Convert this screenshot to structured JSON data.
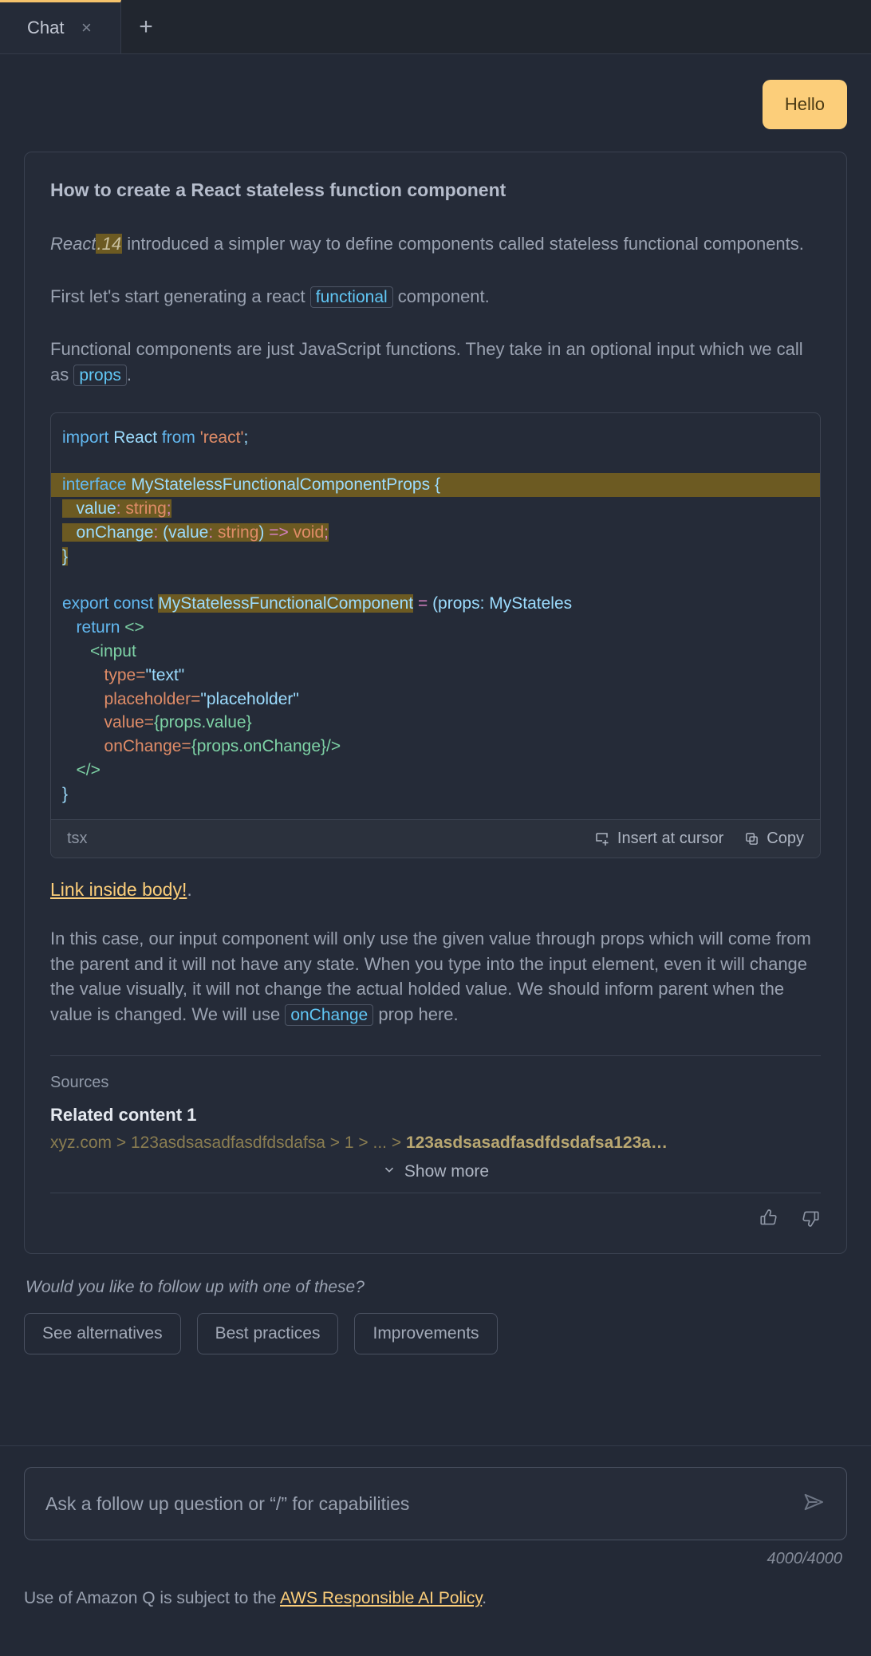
{
  "tabbar": {
    "tab_label": "Chat",
    "close_glyph": "×",
    "new_tab_glyph": "+"
  },
  "conversation": {
    "user_message": "Hello",
    "answer": {
      "title": "How to create a React stateless function component",
      "p1_a": "React",
      "p1_hl": ".14",
      "p1_b": " introduced a simpler way to define components called stateless functional components.",
      "p2_a": "First let's start generating a react ",
      "p2_code": "functional",
      "p2_b": " component.",
      "p3_a": "Functional components are just JavaScript functions. They take in an optional input which we call as ",
      "p3_code": "props",
      "p3_b": ".",
      "link_text": "Link inside body!",
      "link_suffix": ".",
      "p4_a": "In this case, our input component will only use the given value through props which will come from the parent and it will not have any state. When you type into the input element, even it will change the value visually, it will not change the actual holded value. We should inform parent when the value is changed. We will use ",
      "p4_code": "onChange",
      "p4_b": " prop here."
    },
    "code_block": {
      "language": "tsx",
      "insert_label": "Insert at cursor",
      "copy_label": "Copy",
      "lines": [
        "import React from 'react';",
        "",
        "interface MyStatelessFunctionalComponentProps {",
        "    value: string;",
        "    onChange: (value: string) => void;",
        "}",
        "",
        "export const MyStatelessFunctionalComponent = (props: MyStateles",
        "    return <>",
        "        <input",
        "            type=\"text\"",
        "            placeholder=\"placeholder\"",
        "            value={props.value}",
        "            onChange={props.onChange}/>",
        "    </>",
        "}"
      ]
    },
    "sources": {
      "label": "Sources",
      "items": [
        {
          "title": "Related content 1",
          "crumb_prefix": "xyz.com > 123asdsasadfasdfdsdafsa > 1 > ... > ",
          "crumb_last": "123asdsasadfasdfdsdafsa123a…"
        }
      ],
      "show_more_label": "Show more"
    },
    "feedback": {
      "thumbs_up": "thumbs-up-icon",
      "thumbs_down": "thumbs-down-icon"
    }
  },
  "followup": {
    "question": "Would you like to follow up with one of these?",
    "chips": [
      "See alternatives",
      "Best practices",
      "Improvements"
    ]
  },
  "composer": {
    "placeholder": "Ask a follow up question or “/” for capabilities",
    "value": "",
    "counter": "4000/4000",
    "send_icon": "send-icon"
  },
  "footer": {
    "text_prefix": "Use of Amazon Q is subject to the ",
    "link_text": "AWS Responsible AI Policy",
    "text_suffix": "."
  },
  "colors": {
    "accent": "#fcce7a",
    "background": "#232936",
    "card": "#252b38",
    "border": "#3a4150",
    "code_highlight": "#6c5a22",
    "inline_code_text": "#61c7f5"
  }
}
